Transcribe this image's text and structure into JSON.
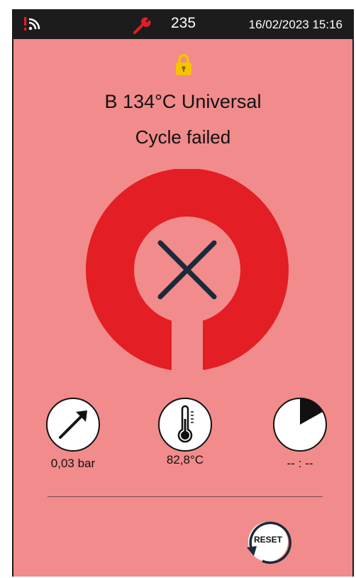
{
  "header": {
    "wifi_icon": "wifi-signal-alert-icon",
    "service_icon": "wrench-icon",
    "cycle_count": "235",
    "datetime": "16/02/2023 15:16"
  },
  "lock_icon": "padlock-icon",
  "program_name": "B 134°C Universal",
  "cycle_status": "Cycle failed",
  "status_icon": "cross-icon",
  "readouts": {
    "pressure": {
      "icon": "pressure-gauge-icon",
      "value": "0,03 bar"
    },
    "temperature": {
      "icon": "thermometer-icon",
      "value": "82,8°C"
    },
    "time": {
      "icon": "timer-icon",
      "value": "-- : --"
    }
  },
  "reset_button": {
    "label": "RESET"
  },
  "colors": {
    "background": "#f28b8b",
    "ring": "#e31e24",
    "topbar": "#1c1c1c",
    "lock": "#f5c400",
    "cross": "#1b2a3a"
  }
}
